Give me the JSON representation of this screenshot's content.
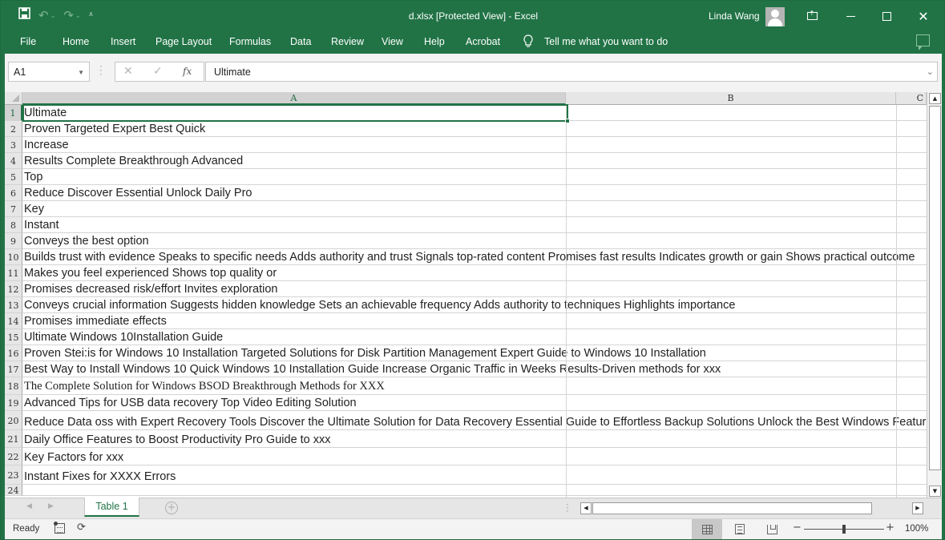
{
  "window": {
    "title": "d.xlsx  [Protected View]  -  Excel",
    "user_name": "Linda Wang",
    "accent_color": "#217346"
  },
  "quick_access": {
    "save": "save-icon",
    "undo": "undo-icon",
    "redo": "redo-icon",
    "customize": "customize-qat-icon"
  },
  "menu": {
    "items": [
      "File",
      "Home",
      "Insert",
      "Page Layout",
      "Formulas",
      "Data",
      "Review",
      "View",
      "Help",
      "Acrobat"
    ],
    "tell_me": "Tell me what you want to do"
  },
  "formula_bar": {
    "name_box": "A1",
    "cancel_glyph": "✕",
    "enter_glyph": "✓",
    "fx_label": "fx",
    "value": "Ultimate"
  },
  "grid": {
    "columns": [
      "A",
      "B",
      "C"
    ],
    "selected_cell": "A1",
    "rows": [
      {
        "n": "1",
        "a": "Ultimate"
      },
      {
        "n": "2",
        "a": "Proven Targeted Expert Best Quick"
      },
      {
        "n": "3",
        "a": "Increase"
      },
      {
        "n": "4",
        "a": "Results Complete Breakthrough Advanced"
      },
      {
        "n": "5",
        "a": "Top"
      },
      {
        "n": "6",
        "a": "Reduce Discover Essential Unlock Daily Pro"
      },
      {
        "n": "7",
        "a": "Key"
      },
      {
        "n": "8",
        "a": "Instant"
      },
      {
        "n": "9",
        "a": "Conveys the best option"
      },
      {
        "n": "10",
        "a": "Builds trust with evidence Speaks to specific needs Adds authority and trust Signals top-rated content Promises fast results Indicates growth or gain Shows practical outcome"
      },
      {
        "n": "11",
        "a": "Makes you feel experienced Shows top quality or"
      },
      {
        "n": "12",
        "a": "Promises decreased risk/effort Invites  exploration"
      },
      {
        "n": "13",
        "a": "Conveys crucial information Suggests hidden knowledge Sets an achievable frequency Adds authority to techniques Highlights  importance"
      },
      {
        "n": "14",
        "a": "Promises immediate effects"
      },
      {
        "n": "15",
        "a": "Ultimate Windows 10Installation Guide"
      },
      {
        "n": "16",
        "a": "Proven Stei:is for Windows 10 Installation Targeted Solutions for Disk Partition Management Expert Guide to Windows 10 Installation"
      },
      {
        "n": "17",
        "a": "Best Way to Install Windows 10 Quick Windows 10 Installation Guide Increase Organic Traffic in Weeks Results-Driven methods for xxx"
      },
      {
        "n": "18",
        "a": "The Complete Solution for Windows BSOD Breakthrough Methods for XXX"
      },
      {
        "n": "19",
        "a": "Advanced Tips for USB data recovery Top Video Editing Solution"
      },
      {
        "n": "20",
        "a": "Reduce Data oss with Expert Recovery Tools Discover the Ultimate Solution for Data Recovery Essential Guide to Effortless Backup Solutions Unlock the Best Windows Features"
      },
      {
        "n": "21",
        "a": "Daily Office Features to Boost Productivity Pro Guide to xxx"
      },
      {
        "n": "22",
        "a": "Key Factors for xxx"
      },
      {
        "n": "23",
        "a": "Instant Fixes for XXXX Errors"
      },
      {
        "n": "24",
        "a": ""
      }
    ]
  },
  "sheets": {
    "tabs": [
      "Table 1"
    ],
    "active": "Table 1"
  },
  "status": {
    "ready": "Ready",
    "zoom": "100%",
    "zoom_fraction": 0.5
  }
}
